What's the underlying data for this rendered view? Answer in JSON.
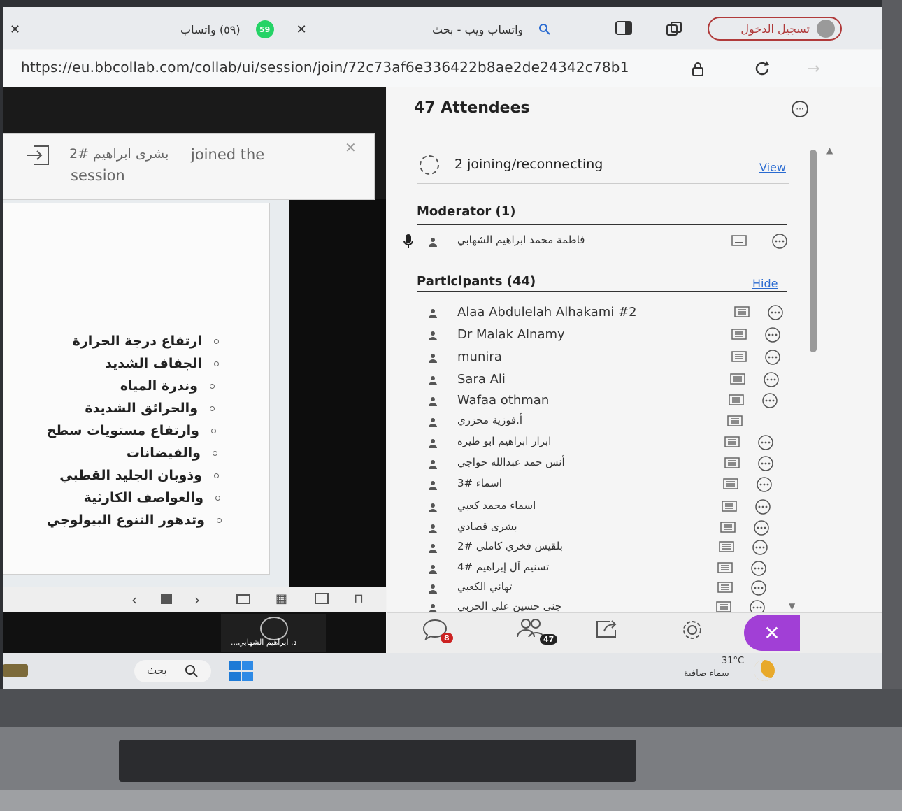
{
  "browser": {
    "tab_whatsapp_title": "(٥٩) واتساب",
    "tab_whatsapp_badge": "59",
    "tab_search_title": "واتساب ويب - بحث",
    "signin_label": "تسجيل الدخول",
    "url": "https://eu.bbcollab.com/collab/ui/session/join/72c73af6e336422b8ae2de24342c78b1"
  },
  "toast": {
    "name": "بشرى ابراهيم #2",
    "message_line1": "joined the",
    "message_line2": "session"
  },
  "slide": {
    "bullets": [
      "ارتفاع درجة الحرارة",
      "الجفاف الشديد",
      "وندرة المياه",
      "والحرائق الشديدة",
      "وارتفاع مستويات سطح",
      "والفيضانات",
      "وذوبان الجليد القطبي",
      "والعواصف الكارثية",
      "وتدهور التنوع البيولوجي"
    ]
  },
  "video": {
    "speaker_label": "د. ابراهيم الشهابي..."
  },
  "attendees": {
    "title": "47 Attendees",
    "joining_text": "2 joining/reconnecting",
    "view_link": "View",
    "moderator_header": "Moderator (1)",
    "moderator_name": "فاطمة محمد ابراهيم الشهابي",
    "participants_header": "Participants (44)",
    "hide_link": "Hide",
    "participants": [
      "Alaa Abdulelah Alhakami #2",
      "Dr Malak Alnamy",
      "munira",
      "Sara Ali",
      "Wafaa othman",
      "أ.فوزية محزري",
      "ابرار ابراهيم ابو طيره",
      "أنس حمد عبدالله حواجي",
      "اسماء #3",
      "اسماء محمد كعبي",
      "بشرى قصادي",
      "بلقيس فخري كاملي #2",
      "تسنيم آل إبراهيم #4",
      "تهاني الكعبي",
      "جنى حسين علي الحربي"
    ]
  },
  "panel_tabs": {
    "chat_badge": "8",
    "attendees_badge": "47"
  },
  "taskbar": {
    "search_label": "بحث",
    "weather_temp": "31°C",
    "weather_desc": "سماء صافية"
  },
  "colors": {
    "accent_purple": "#a13fd6",
    "link_blue": "#2a6bd1",
    "whatsapp_green": "#25d366"
  }
}
